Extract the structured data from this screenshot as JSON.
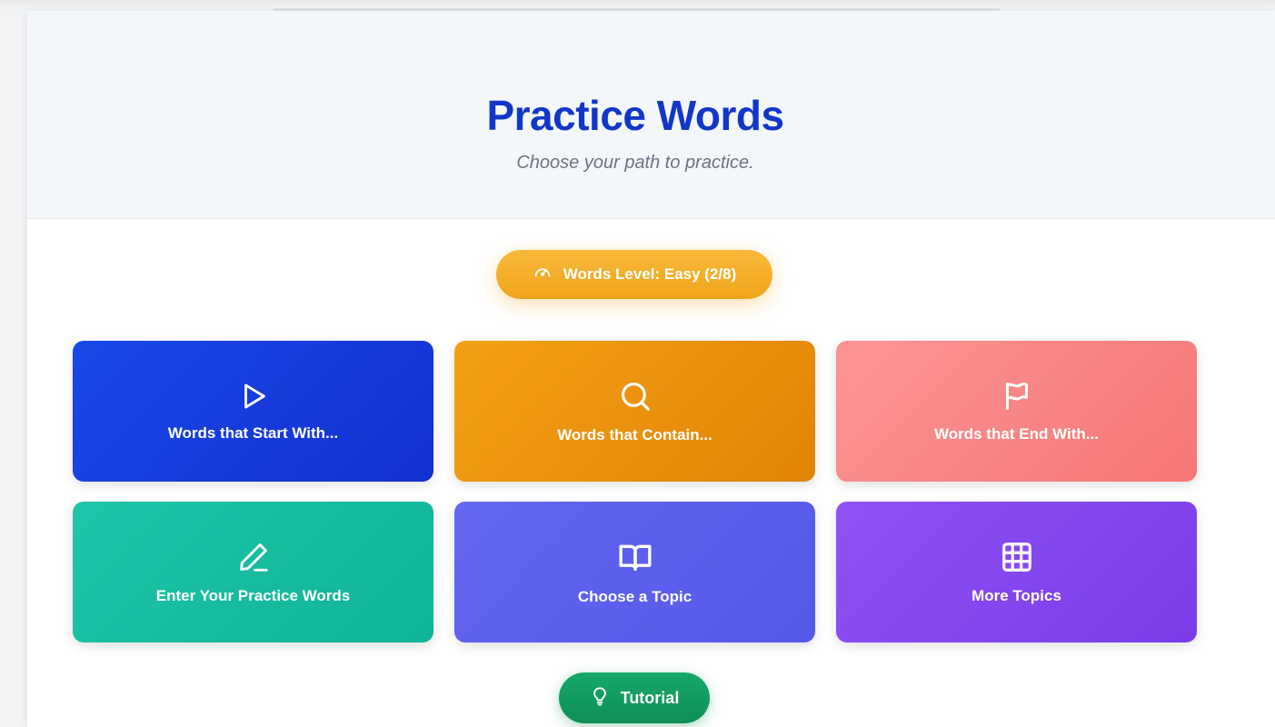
{
  "header": {
    "title": "Practice Words",
    "subtitle": "Choose your path to practice."
  },
  "level_button": {
    "label": "Words Level: Easy (2/8)",
    "icon": "gauge-icon",
    "color": "#f5ab2a"
  },
  "cards": [
    {
      "label": "Words that Start With...",
      "icon": "play-icon",
      "color": "#1a40e0"
    },
    {
      "label": "Words that Contain...",
      "icon": "search-icon",
      "color": "#f0960f"
    },
    {
      "label": "Words that End With...",
      "icon": "flag-icon",
      "color": "#fa8686"
    },
    {
      "label": "Enter Your Practice Words",
      "icon": "pencil-icon",
      "color": "#16bd9f"
    },
    {
      "label": "Choose a Topic",
      "icon": "book-icon",
      "color": "#5d60ee"
    },
    {
      "label": "More Topics",
      "icon": "grid-icon",
      "color": "#8548ef"
    }
  ],
  "tutorial_button": {
    "label": "Tutorial",
    "icon": "lightbulb-icon",
    "color": "#149c60"
  },
  "colors": {
    "title": "#1237c8",
    "header_bg": "#f3f7f9"
  }
}
